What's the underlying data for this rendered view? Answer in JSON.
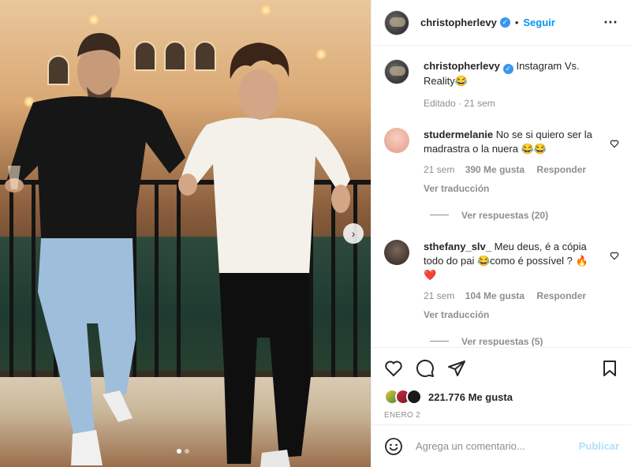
{
  "header": {
    "username": "christopherlevy",
    "separator": "•",
    "follow_label": "Seguir",
    "more_icon": "more-dots-icon"
  },
  "caption": {
    "username": "christopherlevy",
    "text": "Instagram Vs. Reality",
    "emoji": "😂",
    "edited_label": "Editado",
    "time": "21 sem"
  },
  "comments": [
    {
      "username": "studermelanie",
      "text": "No se si quiero ser la madrastra o la nuera 😂😂",
      "time": "21 sem",
      "likes": "390 Me gusta",
      "reply_label": "Responder",
      "translate_label": "Ver traducción",
      "view_replies": "Ver respuestas (20)",
      "avatar_color": "#f2b7a2"
    },
    {
      "username": "sthefany_slv_",
      "text": "Meu deus, é a cópia todo do pai 😂como é possível ? 🔥❤️",
      "time": "21 sem",
      "likes": "104 Me gusta",
      "reply_label": "Responder",
      "translate_label": "Ver traducción",
      "view_replies": "Ver respuestas (5)",
      "avatar_color": "#4a3d38"
    }
  ],
  "actions": {
    "like_icon": "heart-icon",
    "comment_icon": "comment-icon",
    "share_icon": "share-icon",
    "save_icon": "bookmark-icon",
    "likes_count": "221.776 Me gusta",
    "date": "ENERO 2"
  },
  "add_comment": {
    "placeholder": "Agrega un comentario...",
    "publish_label": "Publicar",
    "emoji_icon": "smiley-icon"
  },
  "carousel": {
    "slides": 2,
    "current": 1
  },
  "colors": {
    "link": "#0095f6",
    "muted": "#8e8e8e",
    "verified": "#3897f0",
    "publish_disabled": "#b2dffc"
  }
}
